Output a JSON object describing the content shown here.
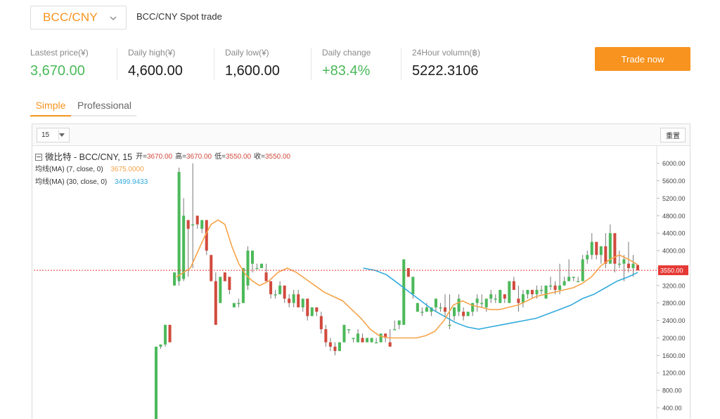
{
  "header": {
    "pair": "BCC/CNY",
    "title": "BCC/CNY Spot trade"
  },
  "stats": [
    {
      "label": "Lastest price(¥)",
      "value": "3,670.00",
      "color": "green"
    },
    {
      "label": "Daily high(¥)",
      "value": "4,600.00",
      "color": "dark"
    },
    {
      "label": "Daily low(¥)",
      "value": "1,600.00",
      "color": "dark"
    },
    {
      "label": "Daily change",
      "value": "+83.4%",
      "color": "green"
    },
    {
      "label": "24Hour volumn(฿)",
      "value": "5222.3106",
      "color": "dark"
    }
  ],
  "trade_button": "Trade now",
  "tabs": {
    "simple": "Simple",
    "professional": "Professional",
    "active": "Simple"
  },
  "chart_toolbar": {
    "interval": "15",
    "reset": "重置"
  },
  "legend": {
    "symbol": "微比特 - BCC/CNY, 15",
    "open_label": "开=",
    "open": "3670.00",
    "high_label": "高=",
    "high": "3670.00",
    "low_label": "低=",
    "low": "3550.00",
    "close_label": "收=",
    "close": "3550.00",
    "ma7_label": "均线(MA) (7, close, 0)",
    "ma7_value": "3675.0000",
    "ma30_label": "均线(MA) (30, close, 0)",
    "ma30_value": "3499.9433"
  },
  "colors": {
    "accent": "#f7931e",
    "up": "#4cb95a",
    "down": "#d14a3d",
    "ma7": "#f7a348",
    "ma30": "#32aadd",
    "price_line": "#e53935"
  },
  "chart_data": {
    "type": "candlestick",
    "y_ticks": [
      "6000.00",
      "5600.00",
      "5200.00",
      "4800.00",
      "4400.00",
      "4000.00",
      "3600.00",
      "3200.00",
      "2800.00",
      "2400.00",
      "2000.00",
      "1600.00",
      "1200.00",
      "800.00",
      "400.00"
    ],
    "ylim": [
      200,
      6300
    ],
    "current_price": 3550,
    "current_price_label": "3550.00",
    "candles": [
      [
        80,
        940,
        80,
        1800
      ],
      [
        1800,
        1850,
        1750,
        1850
      ],
      [
        1850,
        2300,
        1800,
        2300
      ],
      [
        2300,
        2300,
        1900,
        1900
      ],
      [
        3200,
        3500,
        3200,
        3500
      ],
      [
        3300,
        5900,
        3200,
        5800
      ],
      [
        3350,
        5200,
        3300,
        4800
      ],
      [
        4700,
        4700,
        3400,
        4500
      ],
      [
        4600,
        6000,
        3600,
        4600
      ],
      [
        4800,
        4700,
        4500,
        4600
      ],
      [
        4500,
        4700,
        4400,
        4700
      ],
      [
        4700,
        4700,
        3900,
        4000
      ],
      [
        3900,
        3900,
        3300,
        3300
      ],
      [
        3300,
        3500,
        2300,
        2300
      ],
      [
        2800,
        3400,
        2800,
        3400
      ],
      [
        3500,
        3500,
        3300,
        3300
      ],
      [
        3400,
        3400,
        3000,
        3100
      ],
      [
        2700,
        2700,
        2700,
        2800
      ],
      [
        2800,
        2900,
        2700,
        2800
      ],
      [
        2800,
        3600,
        2800,
        3600
      ],
      [
        3200,
        4100,
        3100,
        4000
      ],
      [
        3700,
        4000,
        3500,
        4000
      ],
      [
        3600,
        3700,
        3600,
        3600
      ],
      [
        3600,
        3700,
        3600,
        3700
      ],
      [
        3500,
        3700,
        3300,
        3300
      ],
      [
        3300,
        3300,
        2900,
        3000
      ],
      [
        3000,
        3100,
        2900,
        3000
      ],
      [
        3000,
        3300,
        3000,
        3200
      ],
      [
        3200,
        3200,
        2800,
        2900
      ],
      [
        2900,
        3000,
        2700,
        2800
      ],
      [
        2800,
        3100,
        2700,
        3000
      ],
      [
        3000,
        3100,
        2700,
        2700
      ],
      [
        2700,
        2900,
        2600,
        2900
      ],
      [
        2900,
        2900,
        2400,
        2500
      ],
      [
        2500,
        2700,
        2500,
        2700
      ],
      [
        2700,
        2700,
        2500,
        2600
      ],
      [
        2500,
        2600,
        2100,
        2200
      ],
      [
        2200,
        2300,
        1800,
        1900
      ],
      [
        1900,
        2000,
        1700,
        1800
      ],
      [
        1800,
        1900,
        1600,
        1700
      ],
      [
        1700,
        1900,
        1700,
        1900
      ],
      [
        1900,
        2300,
        1900,
        2300
      ],
      [
        2200,
        2200,
        2100,
        2200
      ],
      [
        2000,
        2000,
        1900,
        2000
      ],
      [
        1900,
        2200,
        1900,
        2100
      ],
      [
        2000,
        2100,
        1900,
        1900
      ],
      [
        1900,
        2000,
        1900,
        2000
      ],
      [
        1900,
        2000,
        1900,
        2000
      ],
      [
        1900,
        2000,
        1900,
        1900
      ],
      [
        1900,
        2100,
        1900,
        2100
      ],
      [
        2100,
        2100,
        1900,
        2000
      ],
      [
        1900,
        2200,
        1800,
        1800
      ],
      [
        2200,
        2400,
        2200,
        2200
      ],
      [
        2300,
        2400,
        2200,
        2400
      ],
      [
        2300,
        3800,
        2300,
        3800
      ],
      [
        3600,
        3600,
        3400,
        3400
      ],
      [
        3000,
        3400,
        2900,
        3400
      ],
      [
        2600,
        2800,
        2600,
        2800
      ],
      [
        2600,
        2700,
        2500,
        2600
      ],
      [
        2600,
        2800,
        2600,
        2700
      ],
      [
        2600,
        2700,
        2500,
        2700
      ],
      [
        2700,
        2900,
        2600,
        2900
      ],
      [
        2700,
        2800,
        2600,
        2700
      ],
      [
        2700,
        3000,
        2500,
        2600
      ],
      [
        2300,
        3000,
        2200,
        2300
      ],
      [
        2500,
        2700,
        2400,
        2700
      ],
      [
        2600,
        3000,
        2500,
        2900
      ],
      [
        2600,
        2700,
        2400,
        2500
      ],
      [
        2500,
        2600,
        2500,
        2600
      ],
      [
        2600,
        2800,
        2500,
        2800
      ],
      [
        2800,
        3000,
        2600,
        2900
      ],
      [
        2800,
        3000,
        2700,
        2800
      ],
      [
        2700,
        2900,
        2600,
        2900
      ],
      [
        2900,
        3100,
        2800,
        3000
      ],
      [
        2900,
        3000,
        2800,
        2900
      ],
      [
        2800,
        3100,
        2800,
        3100
      ],
      [
        3000,
        3000,
        2800,
        2900
      ],
      [
        2800,
        3300,
        2800,
        3300
      ],
      [
        3300,
        3400,
        3100,
        3100
      ],
      [
        2900,
        3200,
        2600,
        2800
      ],
      [
        2800,
        3100,
        2700,
        3000
      ],
      [
        3000,
        3100,
        2900,
        3100
      ],
      [
        3100,
        3100,
        2900,
        3000
      ],
      [
        3000,
        3200,
        2900,
        3100
      ],
      [
        3100,
        3200,
        3000,
        3100
      ],
      [
        2900,
        3200,
        2900,
        3200
      ],
      [
        3200,
        3400,
        3100,
        3200
      ],
      [
        3200,
        3300,
        3000,
        3100
      ],
      [
        3100,
        3700,
        3000,
        3200
      ],
      [
        3200,
        3400,
        3200,
        3300
      ],
      [
        3300,
        3800,
        3300,
        3400
      ],
      [
        3400,
        3400,
        3300,
        3400
      ],
      [
        3300,
        3400,
        3300,
        3300
      ],
      [
        3300,
        3900,
        3300,
        3800
      ],
      [
        3800,
        4000,
        3700,
        3900
      ],
      [
        3900,
        4400,
        3800,
        4200
      ],
      [
        4200,
        4200,
        3800,
        3900
      ],
      [
        3900,
        4100,
        3700,
        4100
      ],
      [
        4100,
        4400,
        3600,
        3700
      ],
      [
        3700,
        4600,
        3700,
        4400
      ],
      [
        4400,
        4400,
        3500,
        3700
      ],
      [
        3700,
        4000,
        3600,
        3700
      ],
      [
        3700,
        3900,
        3300,
        3800
      ],
      [
        3700,
        4200,
        3500,
        3600
      ],
      [
        3600,
        3900,
        3400,
        3700
      ],
      [
        3670,
        3670,
        3550,
        3550
      ]
    ],
    "ma7": [
      [
        0.0,
        3400
      ],
      [
        0.03,
        3600
      ],
      [
        0.06,
        4300
      ],
      [
        0.075,
        4600
      ],
      [
        0.09,
        4700
      ],
      [
        0.105,
        4600
      ],
      [
        0.12,
        4100
      ],
      [
        0.135,
        3700
      ],
      [
        0.15,
        3450
      ],
      [
        0.165,
        3300
      ],
      [
        0.18,
        3200
      ],
      [
        0.2,
        3300
      ],
      [
        0.22,
        3500
      ],
      [
        0.24,
        3600
      ],
      [
        0.26,
        3500
      ],
      [
        0.28,
        3350
      ],
      [
        0.3,
        3200
      ],
      [
        0.32,
        3050
      ],
      [
        0.34,
        2950
      ],
      [
        0.36,
        2850
      ],
      [
        0.38,
        2650
      ],
      [
        0.4,
        2450
      ],
      [
        0.42,
        2200
      ],
      [
        0.44,
        2050
      ],
      [
        0.46,
        2000
      ],
      [
        0.48,
        2000
      ],
      [
        0.5,
        2000
      ],
      [
        0.52,
        2000
      ],
      [
        0.54,
        2050
      ],
      [
        0.56,
        2150
      ],
      [
        0.58,
        2400
      ],
      [
        0.6,
        2750
      ],
      [
        0.62,
        2850
      ],
      [
        0.64,
        2750
      ],
      [
        0.66,
        2700
      ],
      [
        0.68,
        2650
      ],
      [
        0.7,
        2650
      ],
      [
        0.72,
        2700
      ],
      [
        0.74,
        2750
      ],
      [
        0.76,
        2850
      ],
      [
        0.78,
        2950
      ],
      [
        0.8,
        3000
      ],
      [
        0.82,
        3050
      ],
      [
        0.84,
        3100
      ],
      [
        0.86,
        3150
      ],
      [
        0.88,
        3250
      ],
      [
        0.9,
        3400
      ],
      [
        0.92,
        3650
      ],
      [
        0.94,
        3800
      ],
      [
        0.96,
        3900
      ],
      [
        0.98,
        3800
      ],
      [
        1.0,
        3675
      ]
    ],
    "ma30": [
      [
        0.405,
        3600
      ],
      [
        0.43,
        3550
      ],
      [
        0.455,
        3450
      ],
      [
        0.48,
        3250
      ],
      [
        0.505,
        3050
      ],
      [
        0.53,
        2850
      ],
      [
        0.555,
        2650
      ],
      [
        0.58,
        2500
      ],
      [
        0.605,
        2350
      ],
      [
        0.63,
        2250
      ],
      [
        0.655,
        2200
      ],
      [
        0.68,
        2250
      ],
      [
        0.705,
        2300
      ],
      [
        0.73,
        2350
      ],
      [
        0.755,
        2400
      ],
      [
        0.78,
        2450
      ],
      [
        0.805,
        2550
      ],
      [
        0.83,
        2650
      ],
      [
        0.855,
        2750
      ],
      [
        0.88,
        2900
      ],
      [
        0.905,
        3000
      ],
      [
        0.93,
        3150
      ],
      [
        0.955,
        3300
      ],
      [
        0.98,
        3400
      ],
      [
        1.0,
        3500
      ]
    ]
  }
}
